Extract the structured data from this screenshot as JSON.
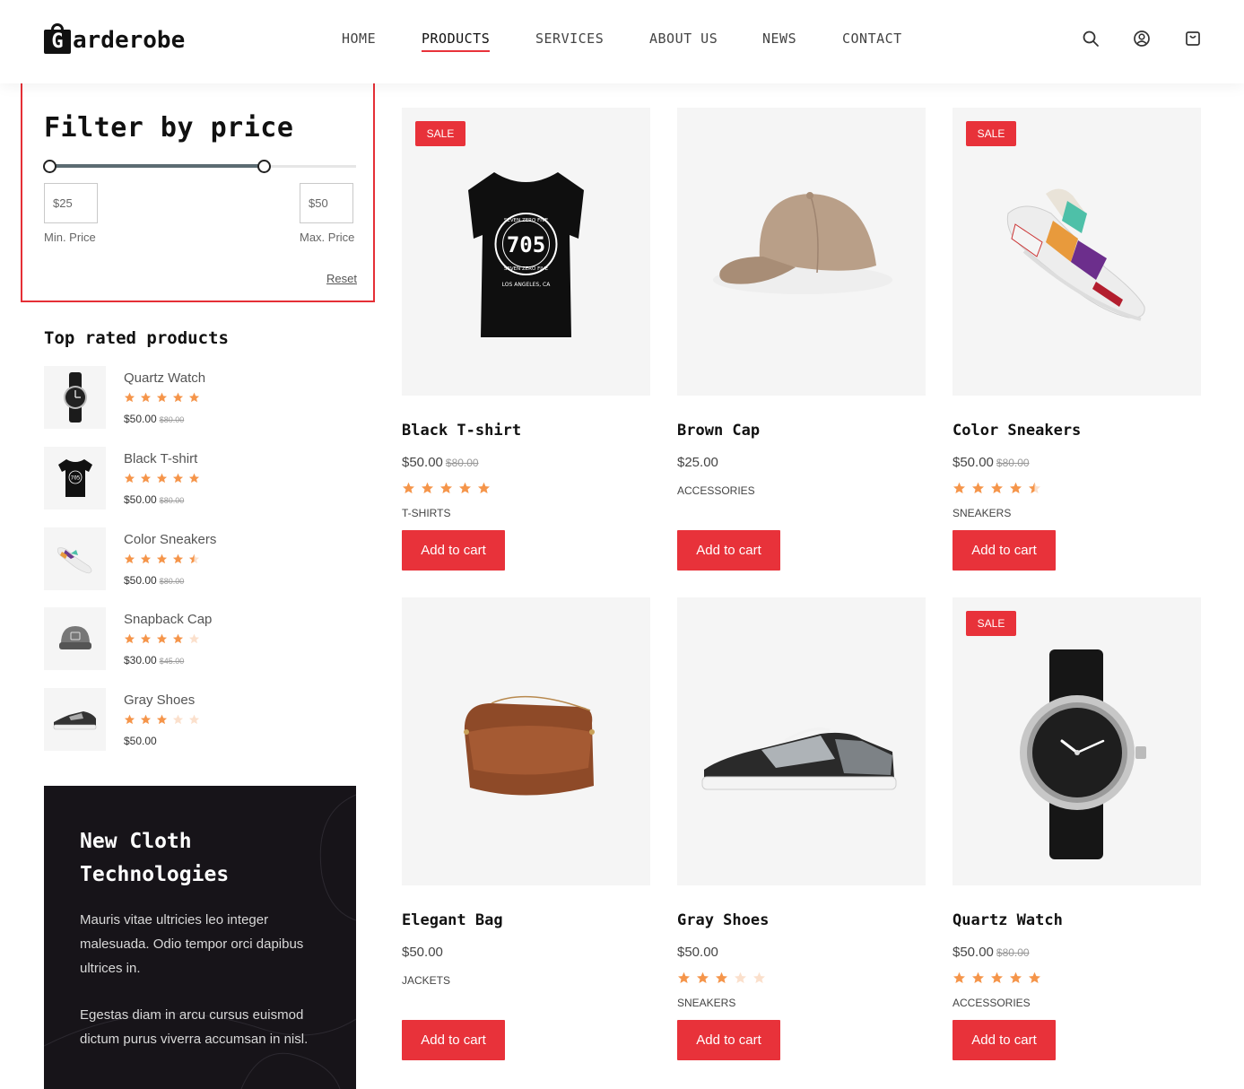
{
  "brand": {
    "logo_letter": "G",
    "logo_rest": "arderobe"
  },
  "nav": {
    "items": [
      "HOME",
      "PRODUCTS",
      "SERVICES",
      "ABOUT US",
      "NEWS",
      "CONTACT"
    ],
    "active": "PRODUCTS"
  },
  "header_icons": [
    "search-icon",
    "user-icon",
    "cart-icon"
  ],
  "filter": {
    "title": "Filter by price",
    "min_value": "$25",
    "max_value": "$50",
    "min_label": "Min. Price",
    "max_label": "Max. Price",
    "reset_label": "Reset",
    "range_min_fraction": 0.0,
    "range_max_fraction": 0.7
  },
  "top_rated": {
    "title": "Top rated products",
    "items": [
      {
        "name": "Quartz Watch",
        "rating": 5,
        "price": "$50.00",
        "old_price": "$80.00"
      },
      {
        "name": "Black T-shirt",
        "rating": 5,
        "price": "$50.00",
        "old_price": "$80.00"
      },
      {
        "name": "Color Sneakers",
        "rating": 4.5,
        "price": "$50.00",
        "old_price": "$80.00"
      },
      {
        "name": "Snapback Cap",
        "rating": 4,
        "price": "$30.00",
        "old_price": "$45.00"
      },
      {
        "name": "Gray Shoes",
        "rating": 3,
        "price": "$50.00",
        "old_price": ""
      }
    ]
  },
  "promo": {
    "title": "New Cloth Technologies",
    "paragraph1": "Mauris vitae ultricies leo integer malesuada. Odio tempor orci dapibus ultrices in.",
    "paragraph2": "Egestas diam in arcu cursus euismod dictum purus viverra accumsan in nisl."
  },
  "products": [
    {
      "name": "Black T-shirt",
      "price": "$50.00",
      "old_price": "$80.00",
      "rating": 5,
      "category": "T-SHIRTS",
      "sale": true,
      "image": "tshirt"
    },
    {
      "name": "Brown Cap",
      "price": "$25.00",
      "old_price": "",
      "rating": 0,
      "category": "ACCESSORIES",
      "sale": false,
      "image": "cap"
    },
    {
      "name": "Color Sneakers",
      "price": "$50.00",
      "old_price": "$80.00",
      "rating": 4.5,
      "category": "SNEAKERS",
      "sale": true,
      "image": "sneakers"
    },
    {
      "name": "Elegant Bag",
      "price": "$50.00",
      "old_price": "",
      "rating": 0,
      "category": "JACKETS",
      "sale": false,
      "image": "bag"
    },
    {
      "name": "Gray Shoes",
      "price": "$50.00",
      "old_price": "",
      "rating": 3,
      "category": "SNEAKERS",
      "sale": false,
      "image": "shoes"
    },
    {
      "name": "Quartz Watch",
      "price": "$50.00",
      "old_price": "$80.00",
      "rating": 5,
      "category": "ACCESSORIES",
      "sale": true,
      "image": "watch"
    }
  ],
  "sale_label": "SALE",
  "add_to_cart_label": "Add to cart",
  "colors": {
    "accent": "#e8323a",
    "star": "#f5954a",
    "star_empty": "#fbe0cc",
    "promo_bg": "#171419"
  },
  "tshirt_print": {
    "number": "705",
    "ring_text": "SEVEN ZERO FIVE",
    "city": "LOS ANGELES, CA"
  }
}
